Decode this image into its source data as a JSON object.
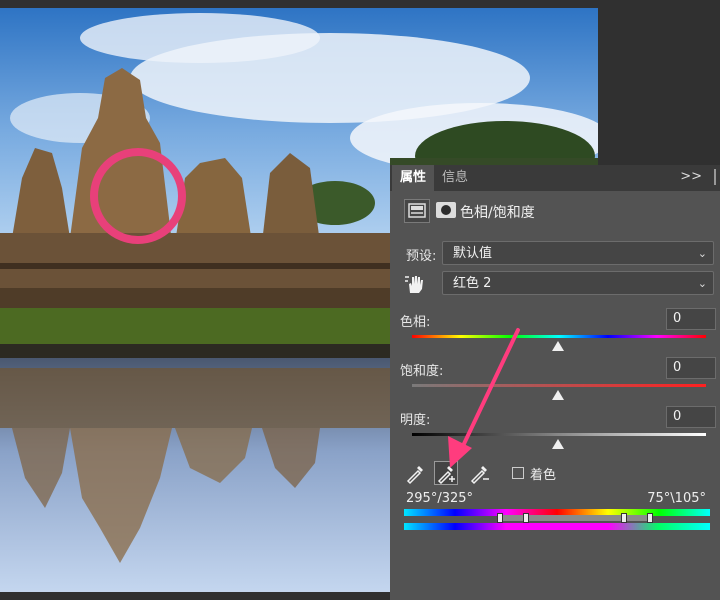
{
  "panel": {
    "tabs": [
      {
        "label": "属性"
      },
      {
        "label": "信息"
      }
    ],
    "menu_icon": "double-chevron-right-icon",
    "adjustment_title": "色相/饱和度",
    "preset": {
      "label": "预设:",
      "value": "默认值"
    },
    "channel": {
      "value": "红色 2"
    },
    "sliders": [
      {
        "label": "色相:",
        "value": "0"
      },
      {
        "label": "饱和度:",
        "value": "0"
      },
      {
        "label": "明度:",
        "value": "0"
      }
    ],
    "colorize": {
      "label": "着色",
      "checked": false
    },
    "range": {
      "left": "295°/325°",
      "right": "75°\\105°"
    }
  },
  "annotations": {
    "circle_color": "#e8407a",
    "arrow_color": "#ff3c7e"
  }
}
